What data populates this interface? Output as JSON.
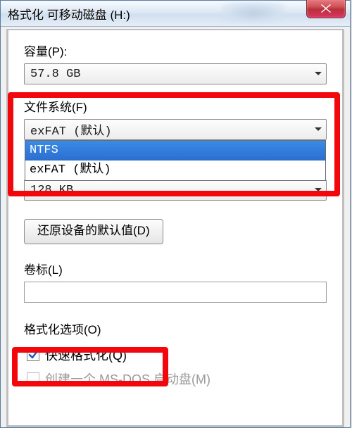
{
  "window": {
    "title": "格式化 可移动磁盘 (H:)"
  },
  "capacity": {
    "label": "容量(P):",
    "value": "57.8 GB"
  },
  "filesystem": {
    "label": "文件系统(F)",
    "value": "exFAT (默认)",
    "options": [
      {
        "text": "NTFS",
        "selected": true
      },
      {
        "text": "exFAT (默认)",
        "selected": false
      }
    ]
  },
  "allocation": {
    "value": "128 KB"
  },
  "restore_defaults": {
    "label": "还原设备的默认值(D)"
  },
  "volume_label": {
    "label": "卷标(L)",
    "value": ""
  },
  "format_options": {
    "label": "格式化选项(O)",
    "quick_format": {
      "label": "快速格式化(Q)",
      "checked": true
    },
    "msdos_boot": {
      "label": "创建一个 MS-DOS 启动盘(M)",
      "checked": false,
      "disabled": true
    }
  }
}
